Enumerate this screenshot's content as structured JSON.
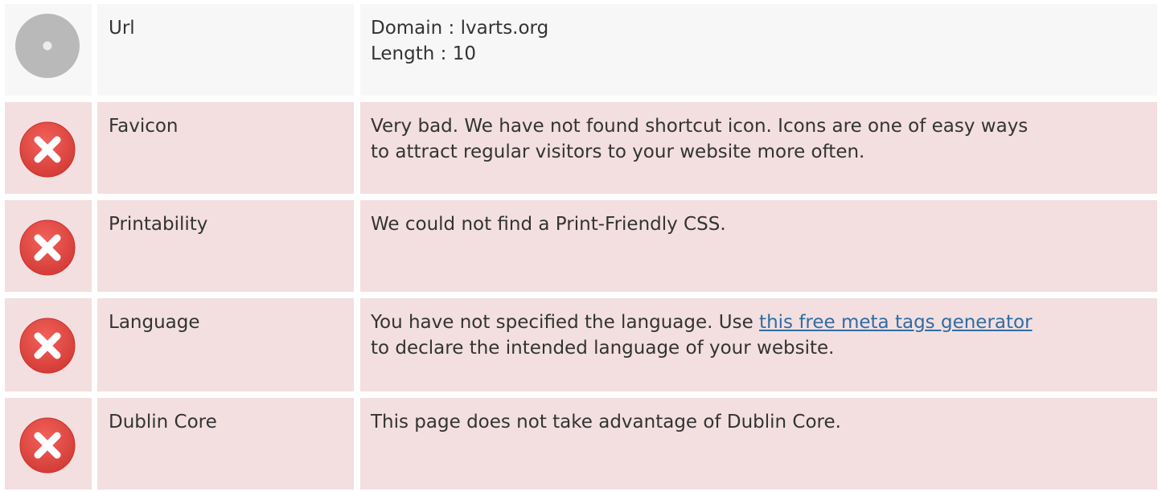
{
  "rows": [
    {
      "status": "neutral",
      "icon": "info-disc-icon",
      "label": "Url",
      "lines": [
        "Domain : lvarts.org",
        "Length : 10"
      ]
    },
    {
      "status": "bad",
      "icon": "error-x-icon",
      "label": "Favicon",
      "lines": [
        "Very bad. We have not found shortcut icon. Icons are one of easy ways",
        "to attract regular visitors to your website more often."
      ]
    },
    {
      "status": "bad",
      "icon": "error-x-icon",
      "label": "Printability",
      "lines": [
        "We could not find a Print-Friendly CSS."
      ]
    },
    {
      "status": "bad",
      "icon": "error-x-icon",
      "label": "Language",
      "line1_prefix": "You have not specified the language. Use ",
      "link_text": "this free meta tags generator",
      "line2": "to declare the intended language of your website."
    },
    {
      "status": "bad",
      "icon": "error-x-icon",
      "label": "Dublin Core",
      "lines": [
        "This page does not take advantage of Dublin Core."
      ]
    }
  ],
  "colors": {
    "neutral_bg": "#f7f7f7",
    "bad_bg": "#f3dfe0",
    "error_red": "#e0443e",
    "link": "#2e6da4",
    "text": "#333333"
  }
}
